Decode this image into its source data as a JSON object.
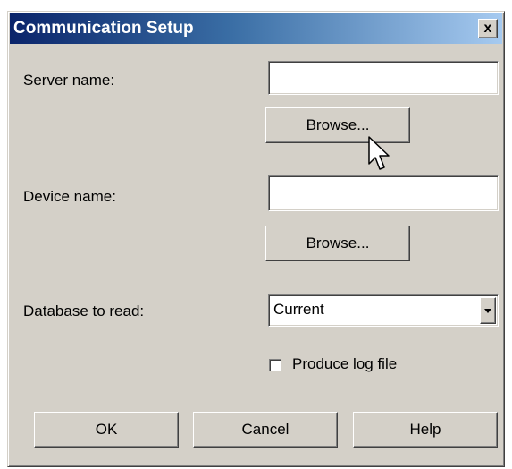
{
  "window": {
    "title": "Communication Setup",
    "close_label": "x"
  },
  "server": {
    "label": "Server name:",
    "value": "",
    "browse_label": "Browse..."
  },
  "device": {
    "label": "Device name:",
    "value": "",
    "browse_label": "Browse..."
  },
  "database": {
    "label": "Database to read:",
    "selected": "Current"
  },
  "log_file": {
    "label": "Produce log file",
    "checked": false
  },
  "footer": {
    "ok_label": "OK",
    "cancel_label": "Cancel",
    "help_label": "Help"
  },
  "colors": {
    "title_start": "#0a246a",
    "title_end": "#a6caf0",
    "face": "#d4d0c8"
  }
}
